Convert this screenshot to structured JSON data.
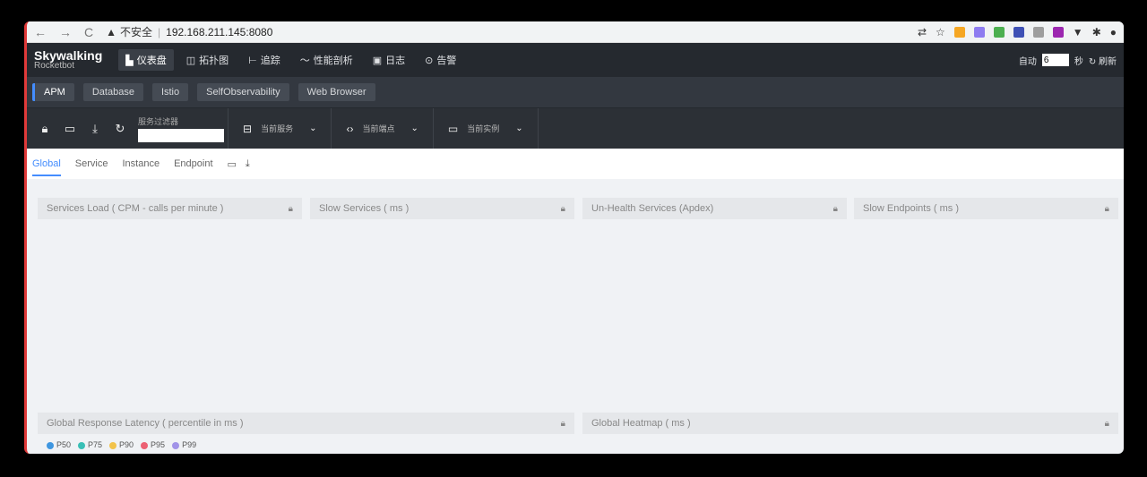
{
  "browser": {
    "security_label": "不安全",
    "url": "192.168.211.145:8080"
  },
  "app": {
    "logo_line1": "Skywalking",
    "logo_line2": "Rocketbot"
  },
  "menu": [
    {
      "label": "仪表盘",
      "icon": "dashboard-icon",
      "active": true
    },
    {
      "label": "拓扑图",
      "icon": "topology-icon"
    },
    {
      "label": "追踪",
      "icon": "trace-icon"
    },
    {
      "label": "性能剖析",
      "icon": "profile-icon"
    },
    {
      "label": "日志",
      "icon": "log-icon"
    },
    {
      "label": "告警",
      "icon": "alarm-icon"
    }
  ],
  "autorefresh": {
    "label": "自动",
    "value": "6",
    "unit": "秒",
    "refresh_label": "刷新"
  },
  "layers": [
    "APM",
    "Database",
    "Istio",
    "SelfObservability",
    "Web Browser"
  ],
  "toolbar": {
    "filter_label": "服务过滤器",
    "current_service": "当前服务",
    "current_endpoint": "当前端点",
    "current_instance": "当前实例"
  },
  "tabs": [
    "Global",
    "Service",
    "Instance",
    "Endpoint"
  ],
  "cards": {
    "services_load": "Services Load ( CPM - calls per minute )",
    "slow_services": "Slow Services ( ms )",
    "unhealth_services": "Un-Health Services (Apdex)",
    "slow_endpoints": "Slow Endpoints ( ms )",
    "global_latency": "Global Response Latency ( percentile in ms )",
    "global_heatmap": "Global Heatmap ( ms )"
  },
  "legend": [
    {
      "label": "P50",
      "color": "#3f96e0"
    },
    {
      "label": "P75",
      "color": "#39bfb6"
    },
    {
      "label": "P90",
      "color": "#f2c34b"
    },
    {
      "label": "P95",
      "color": "#ec6173"
    },
    {
      "label": "P99",
      "color": "#a193e8"
    }
  ]
}
